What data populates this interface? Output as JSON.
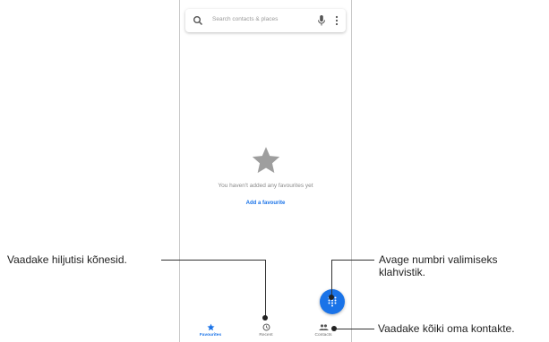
{
  "search": {
    "placeholder": "Search contacts & places"
  },
  "empty_state": {
    "message": "You haven't added any favourites yet",
    "add_link": "Add a favourite"
  },
  "bottom_nav": {
    "items": [
      {
        "label": "Favourites",
        "icon": "star-icon",
        "active": true
      },
      {
        "label": "Recent",
        "icon": "clock-icon",
        "active": false
      },
      {
        "label": "Contacts",
        "icon": "people-icon",
        "active": false
      }
    ]
  },
  "callouts": {
    "recent": "Vaadake hiljutisi kõnesid.",
    "dialpad_line1": "Avage numbri valimiseks",
    "dialpad_line2": "klahvistik.",
    "contacts": "Vaadake kõiki oma kontakte."
  },
  "colors": {
    "accent": "#1a73e8",
    "star_gray": "#9e9e9e",
    "text_gray": "#8a8a8a"
  }
}
